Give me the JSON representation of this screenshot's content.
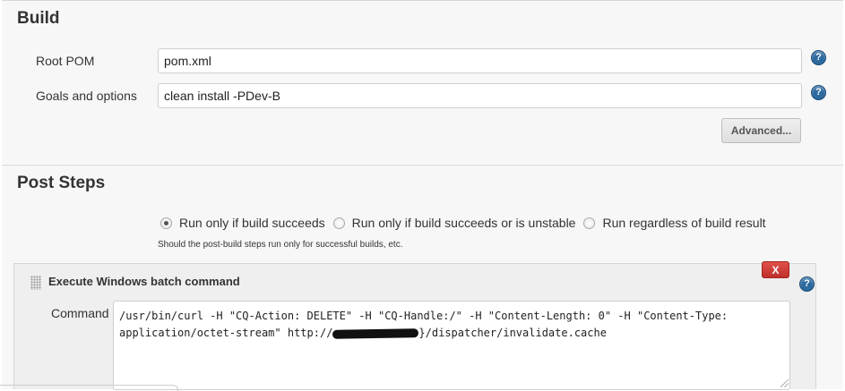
{
  "build": {
    "title": "Build",
    "root_pom_label": "Root POM",
    "root_pom_value": "pom.xml",
    "goals_label": "Goals and options",
    "goals_value": "clean install -PDev-B",
    "advanced_label": "Advanced..."
  },
  "post_steps": {
    "title": "Post Steps",
    "options": [
      {
        "label": "Run only if build succeeds",
        "selected": true
      },
      {
        "label": "Run only if build succeeds or is unstable",
        "selected": false
      },
      {
        "label": "Run regardless of build result",
        "selected": false
      }
    ],
    "hint": "Should the post-build steps run only for successful builds, etc."
  },
  "step": {
    "title": "Execute Windows batch command",
    "delete_label": "X",
    "command_label": "Command",
    "command_before": "/usr/bin/curl -H \"CQ-Action: DELETE\" -H \"CQ-Handle:/\" -H \"Content-Length: 0\" -H \"Content-Type:\napplication/octet-stream\" http://",
    "command_after": "}/dispatcher/invalidate.cache"
  },
  "icons": {
    "help": "?"
  },
  "colors": {
    "panel_bg": "#f7f7f7",
    "help_icon": "#2d6a9f",
    "delete_button": "#c9362f"
  }
}
